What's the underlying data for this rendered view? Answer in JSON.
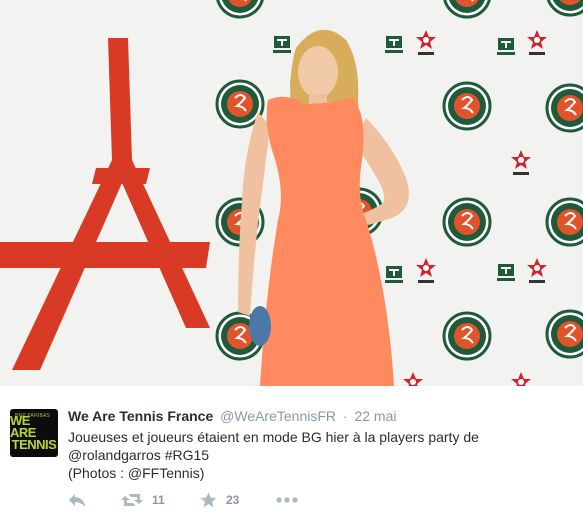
{
  "tweet": {
    "account_name": "We Are Tennis France",
    "handle": "@WeAreTennisFR",
    "separator": "·",
    "timestamp": "22 mai",
    "text_line1": "Joueuses et joueurs étaient en mode BG hier à la players party de",
    "mention": "@rolandgarros",
    "hashtag": "#RG15",
    "credits_open": "(Photos : ",
    "credits_mention": "@FFTennis",
    "credits_close": ")"
  },
  "avatar": {
    "sponsor": "BNP PARIBAS",
    "line1": "WE ARE",
    "line2": "TENNIS",
    "accent_color": "#b9d532"
  },
  "photo_backdrop": {
    "logo_ring_text": "ROLAND GARROS",
    "logo_year": "2015",
    "logo_color": "#e0532b",
    "tennis_channel_label": "TENNIS",
    "star_color": "#d2232a"
  },
  "actions": {
    "reply_icon": "reply-icon",
    "retweet_icon": "retweet-icon",
    "retweet_count": "11",
    "favorite_icon": "star-icon",
    "favorite_count": "23",
    "more_icon": "more-dots-icon",
    "icon_color": "#aab8c2"
  }
}
